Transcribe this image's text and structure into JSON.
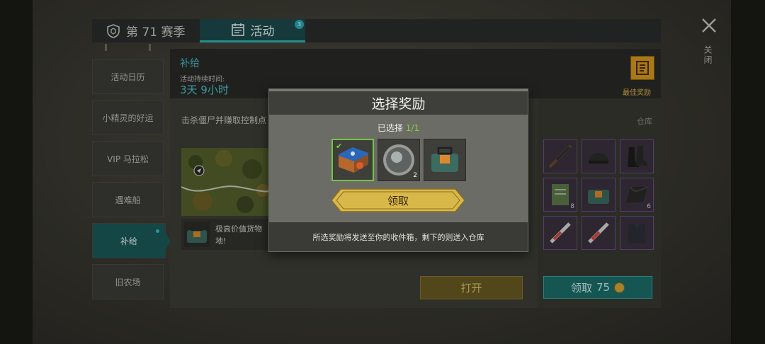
{
  "tabs": {
    "season_label": "第 71 赛季",
    "event_label": "活动",
    "event_badge": "3"
  },
  "sidebar": {
    "items": [
      {
        "label": "活动日历"
      },
      {
        "label": "小精灵的好运"
      },
      {
        "label": "VIP 马拉松"
      },
      {
        "label": "遇难船"
      },
      {
        "label": "补给",
        "active": true
      },
      {
        "label": "旧农场"
      }
    ]
  },
  "main": {
    "section_title": "补给",
    "duration_label": "活动持续时间:",
    "duration_value": "3天 9小时",
    "best_reward_label": "最佳奖励",
    "description": "击杀僵尸并赚取控制点",
    "prize_text": "极高价值货物 地!",
    "open_button": "打开"
  },
  "depot": {
    "label": "仓库",
    "slots": [
      {
        "icon": "rifle-icon",
        "count": ""
      },
      {
        "icon": "helmet-icon",
        "count": ""
      },
      {
        "icon": "boots-icon",
        "count": ""
      },
      {
        "icon": "notebook-icon",
        "count": "8"
      },
      {
        "icon": "supply-bag-icon",
        "count": ""
      },
      {
        "icon": "fabric-icon",
        "count": "6"
      },
      {
        "icon": "syringe-icon",
        "count": ""
      },
      {
        "icon": "syringe-icon",
        "count": ""
      },
      {
        "icon": "vest-icon",
        "count": ""
      }
    ],
    "collect_label": "领取",
    "collect_cost": "75"
  },
  "close_label": "关闭",
  "modal": {
    "title": "选择奖励",
    "selected_prefix": "已选择",
    "selected_count": "1/1",
    "options": [
      {
        "icon": "book-icon",
        "selected": true,
        "count": ""
      },
      {
        "icon": "lens-icon",
        "selected": false,
        "count": "2"
      },
      {
        "icon": "supply-bag-icon",
        "selected": false,
        "count": ""
      }
    ],
    "claim_button": "领取",
    "footer_note": "所选奖励将发送至你的收件箱，剩下的则送入仓库"
  },
  "colors": {
    "accent_teal": "#2fb8b8",
    "gold": "#d4b24a",
    "selection_green": "#76c442"
  }
}
